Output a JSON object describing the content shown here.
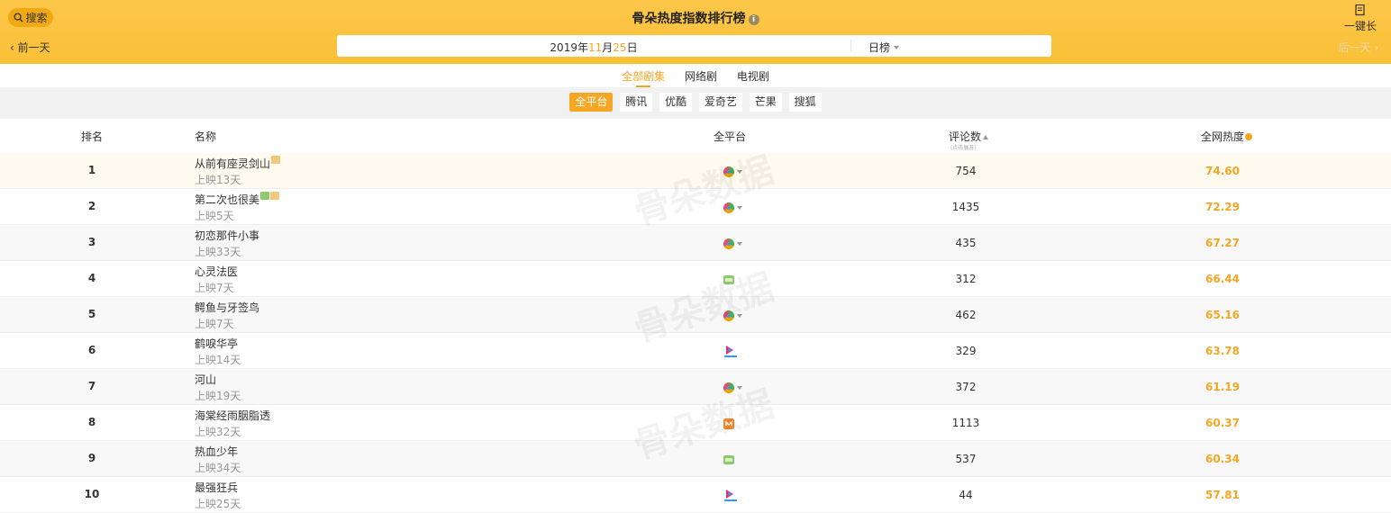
{
  "header": {
    "search_label": "搜索",
    "title": "骨朵热度指数排行榜",
    "oneclick_label": "一键长",
    "prev_label": "前一天",
    "next_label": "后一天"
  },
  "date": {
    "year": "2019",
    "month": "11",
    "day": "25",
    "period": "日榜"
  },
  "tabs": [
    {
      "label": "全部剧集",
      "active": true
    },
    {
      "label": "网络剧",
      "active": false
    },
    {
      "label": "电视剧",
      "active": false
    }
  ],
  "platforms": [
    {
      "label": "全平台",
      "active": true
    },
    {
      "label": "腾讯",
      "active": false
    },
    {
      "label": "优酷",
      "active": false
    },
    {
      "label": "爱奇艺",
      "active": false
    },
    {
      "label": "芒果",
      "active": false
    },
    {
      "label": "搜狐",
      "active": false
    }
  ],
  "table": {
    "headers": {
      "rank": "排名",
      "name": "名称",
      "platform": "全平台",
      "comments": "评论数",
      "comments_sub": "(点击展开)",
      "heat": "全网热度"
    },
    "rows": [
      {
        "rank": "1",
        "name": "从前有座灵剑山",
        "days": "上映13天",
        "tags": [
          "orange"
        ],
        "platform": "iqiyi-multi",
        "comments": "754",
        "heat": "74.60"
      },
      {
        "rank": "2",
        "name": "第二次也很美",
        "days": "上映5天",
        "tags": [
          "green",
          "orange"
        ],
        "platform": "iqiyi-multi",
        "comments": "1435",
        "heat": "72.29"
      },
      {
        "rank": "3",
        "name": "初恋那件小事",
        "days": "上映33天",
        "tags": [],
        "platform": "iqiyi-multi",
        "comments": "435",
        "heat": "67.27"
      },
      {
        "rank": "4",
        "name": "心灵法医",
        "days": "上映7天",
        "tags": [],
        "platform": "iqiyi",
        "comments": "312",
        "heat": "66.44"
      },
      {
        "rank": "5",
        "name": "鳄鱼与牙签鸟",
        "days": "上映7天",
        "tags": [],
        "platform": "iqiyi-multi",
        "comments": "462",
        "heat": "65.16"
      },
      {
        "rank": "6",
        "name": "鹤唳华亭",
        "days": "上映14天",
        "tags": [],
        "platform": "youku",
        "comments": "329",
        "heat": "63.78"
      },
      {
        "rank": "7",
        "name": "河山",
        "days": "上映19天",
        "tags": [],
        "platform": "iqiyi-multi",
        "comments": "372",
        "heat": "61.19"
      },
      {
        "rank": "8",
        "name": "海棠经雨胭脂透",
        "days": "上映32天",
        "tags": [],
        "platform": "mango",
        "comments": "1113",
        "heat": "60.37"
      },
      {
        "rank": "9",
        "name": "热血少年",
        "days": "上映34天",
        "tags": [],
        "platform": "iqiyi",
        "comments": "537",
        "heat": "60.34"
      },
      {
        "rank": "10",
        "name": "最强狂兵",
        "days": "上映25天",
        "tags": [],
        "platform": "youku",
        "comments": "44",
        "heat": "57.81"
      }
    ]
  },
  "watermark": "骨朵数据",
  "colors": {
    "header_bg": "#fcc64a",
    "accent": "#f5a623"
  }
}
